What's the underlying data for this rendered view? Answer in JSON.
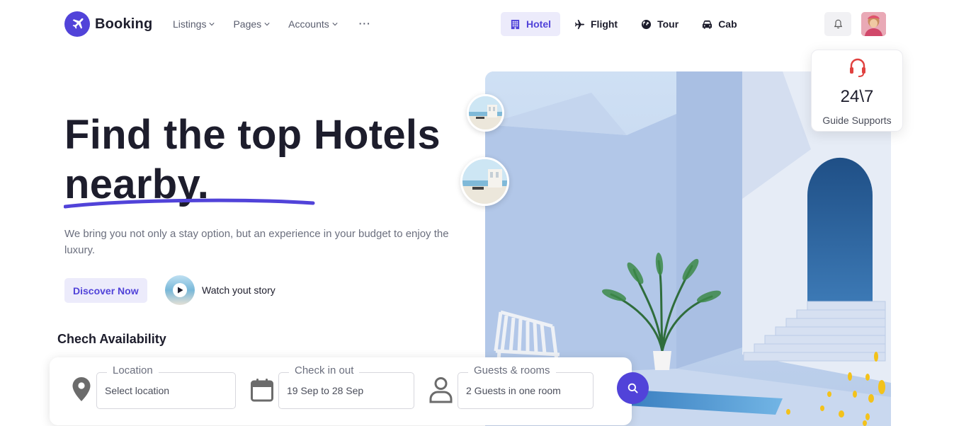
{
  "brand": {
    "name": "Booking",
    "accent": "#5143d9"
  },
  "nav": {
    "menu": [
      {
        "label": "Listings",
        "icon": "chevron-down-icon"
      },
      {
        "label": "Pages",
        "icon": "chevron-down-icon"
      },
      {
        "label": "Accounts",
        "icon": "chevron-down-icon"
      }
    ],
    "more": "···",
    "categories": [
      {
        "label": "Hotel",
        "icon": "hotel-icon",
        "active": true
      },
      {
        "label": "Flight",
        "icon": "plane-icon",
        "active": false
      },
      {
        "label": "Tour",
        "icon": "globe-icon",
        "active": false
      },
      {
        "label": "Cab",
        "icon": "car-icon",
        "active": false
      }
    ]
  },
  "hero": {
    "title_line1": "Find the top Hotels",
    "title_line2": "nearby.",
    "subtitle": "We bring you not only a stay option, but an experience in your budget to enjoy the luxury.",
    "cta": "Discover Now",
    "watch_label": "Watch yout story"
  },
  "support": {
    "number": "24\\7",
    "label": "Guide Supports",
    "icon": "headset-icon",
    "icon_color": "#e0413f"
  },
  "availability": {
    "heading": "Chech Availability",
    "fields": [
      {
        "legend": "Location",
        "value": "Select location",
        "icon": "map-pin-icon"
      },
      {
        "legend": "Check in out",
        "value": "19 Sep to 28 Sep",
        "icon": "calendar-icon"
      },
      {
        "legend": "Guests & rooms",
        "value": "2 Guests in one room",
        "icon": "person-icon"
      }
    ],
    "search_icon": "search-icon"
  }
}
